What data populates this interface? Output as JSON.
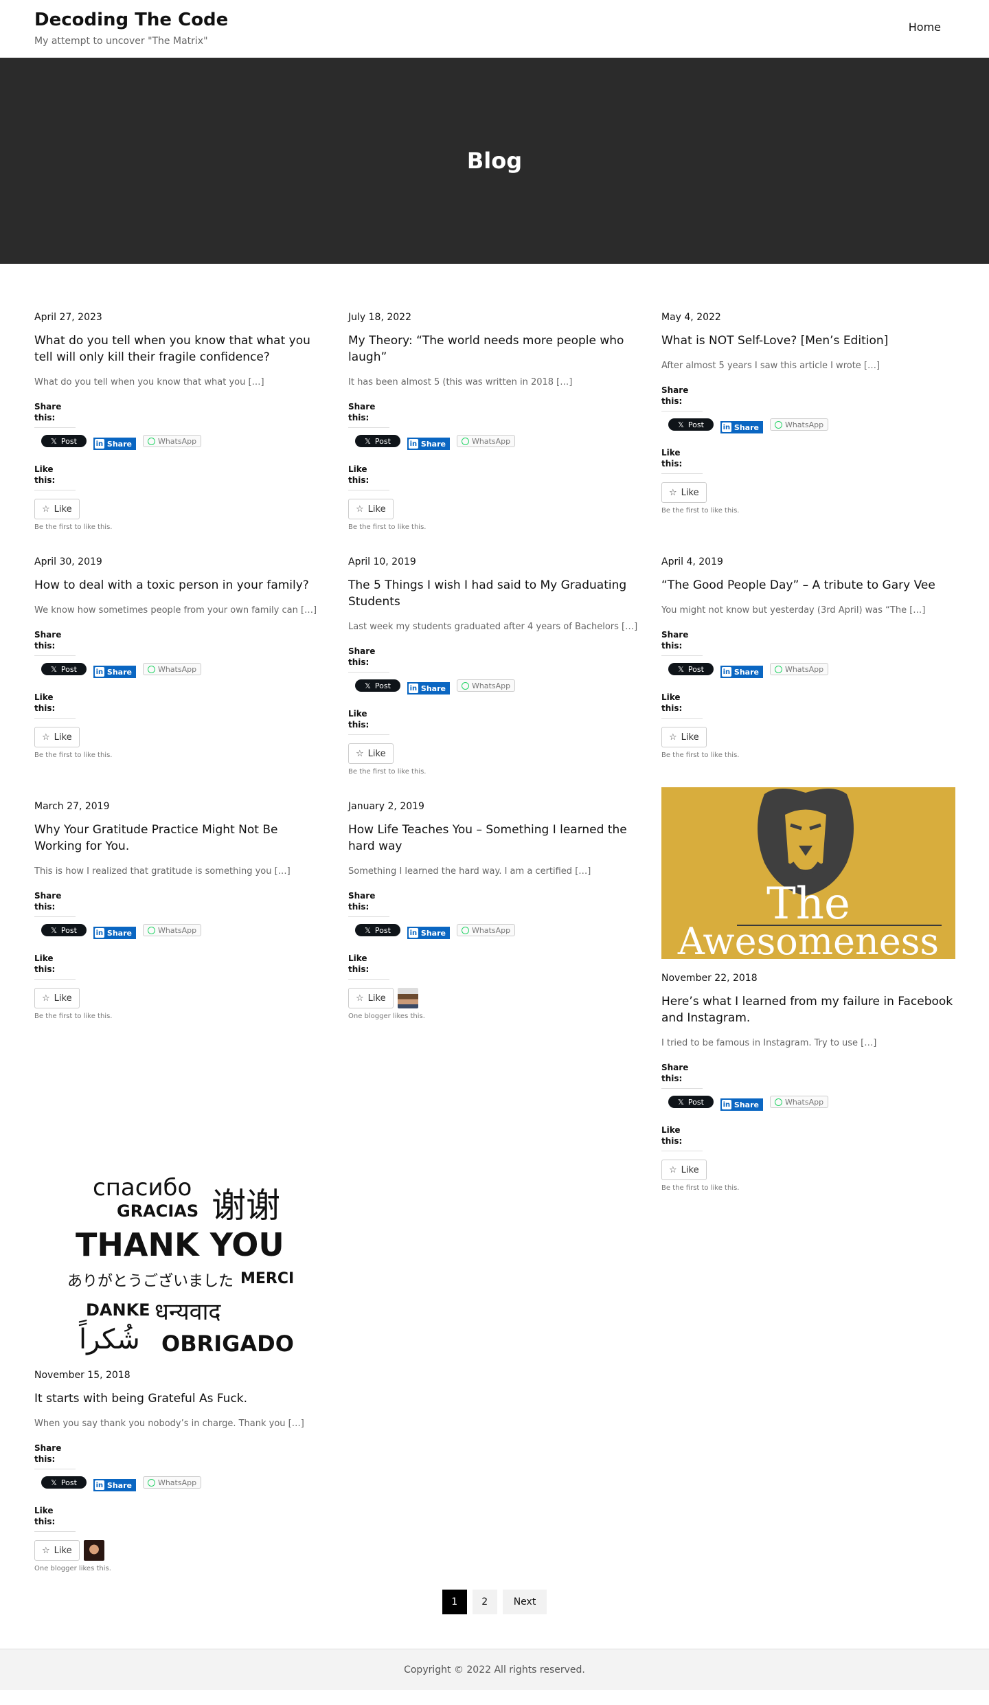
{
  "site": {
    "title": "Decoding The Code",
    "tagline": "My attempt to uncover \"The Matrix\"",
    "nav_home": "Home"
  },
  "hero": {
    "title": "Blog"
  },
  "labels": {
    "share_this": "Share this:",
    "like_this": "Like this:",
    "x_post": "Post",
    "linkedin_share": "Share",
    "whatsapp": "WhatsApp",
    "like": "Like",
    "first_to_like": "Be the first to like this.",
    "one_blogger": "One blogger likes this."
  },
  "posts": [
    {
      "date": "April 27, 2023",
      "title": "What do you tell when you know that what you tell will only kill their fragile confidence?",
      "excerpt": "What do you tell when you know that what you […]",
      "likes_note": "first"
    },
    {
      "date": "July 18, 2022",
      "title": "My Theory: “The world needs more people who laugh”",
      "excerpt": "It has been almost 5 (this was written in 2018 […]",
      "likes_note": "first"
    },
    {
      "date": "May 4, 2022",
      "title": "What is NOT Self-Love? [Men’s Edition]",
      "excerpt": "After almost 5 years I saw this article I wrote […]",
      "likes_note": "first"
    },
    {
      "date": "April 30, 2019",
      "title": "How to deal with a toxic person in your family?",
      "excerpt": "We know how sometimes people from your own family can […]",
      "likes_note": "first"
    },
    {
      "date": "April 10, 2019",
      "title": "The 5 Things I wish I had said to My Graduating Students",
      "excerpt": "Last week my students graduated after 4 years of Bachelors […]",
      "likes_note": "first"
    },
    {
      "date": "April 4, 2019",
      "title": "“The Good People Day” – A tribute to Gary Vee",
      "excerpt": "You might not know but yesterday (3rd April) was “The […]",
      "likes_note": "first"
    },
    {
      "date": "March 27, 2019",
      "title": "Why Your Gratitude Practice Might Not Be Working for You.",
      "excerpt": "This is how I realized that gratitude is something you […]",
      "likes_note": "first"
    },
    {
      "date": "January 2, 2019",
      "title": "How Life Teaches You – Something I learned the hard way",
      "excerpt": "Something I learned the hard way. I am a certified […]",
      "likes_note": "one"
    },
    {
      "date": "November 22, 2018",
      "title": "Here’s what I learned from my failure in Facebook and Instagram.",
      "excerpt": "I tried to be famous in Instagram. Try to use […]",
      "likes_note": "first",
      "image": {
        "line1": "The",
        "line2": "Awesomeness"
      }
    },
    {
      "date": "November 15, 2018",
      "title": "It starts with being Grateful As Fuck.",
      "excerpt": "When you say thank you nobody’s in charge. Thank you […]",
      "likes_note": "one",
      "image": {
        "w1": "спасибо",
        "w2": "谢谢",
        "w3": "GRACIAS",
        "w4": "THANK YOU",
        "w5": "ありがとうございました",
        "w6": "MERCI",
        "w7": "DANKE",
        "w8": "धन्यवाद",
        "w9": "شُكراً",
        "w10": "OBRIGADO"
      }
    }
  ],
  "pagination": {
    "page1": "1",
    "page2": "2",
    "next": "Next"
  },
  "footer": {
    "copyright": "Copyright © 2022 All rights reserved."
  }
}
